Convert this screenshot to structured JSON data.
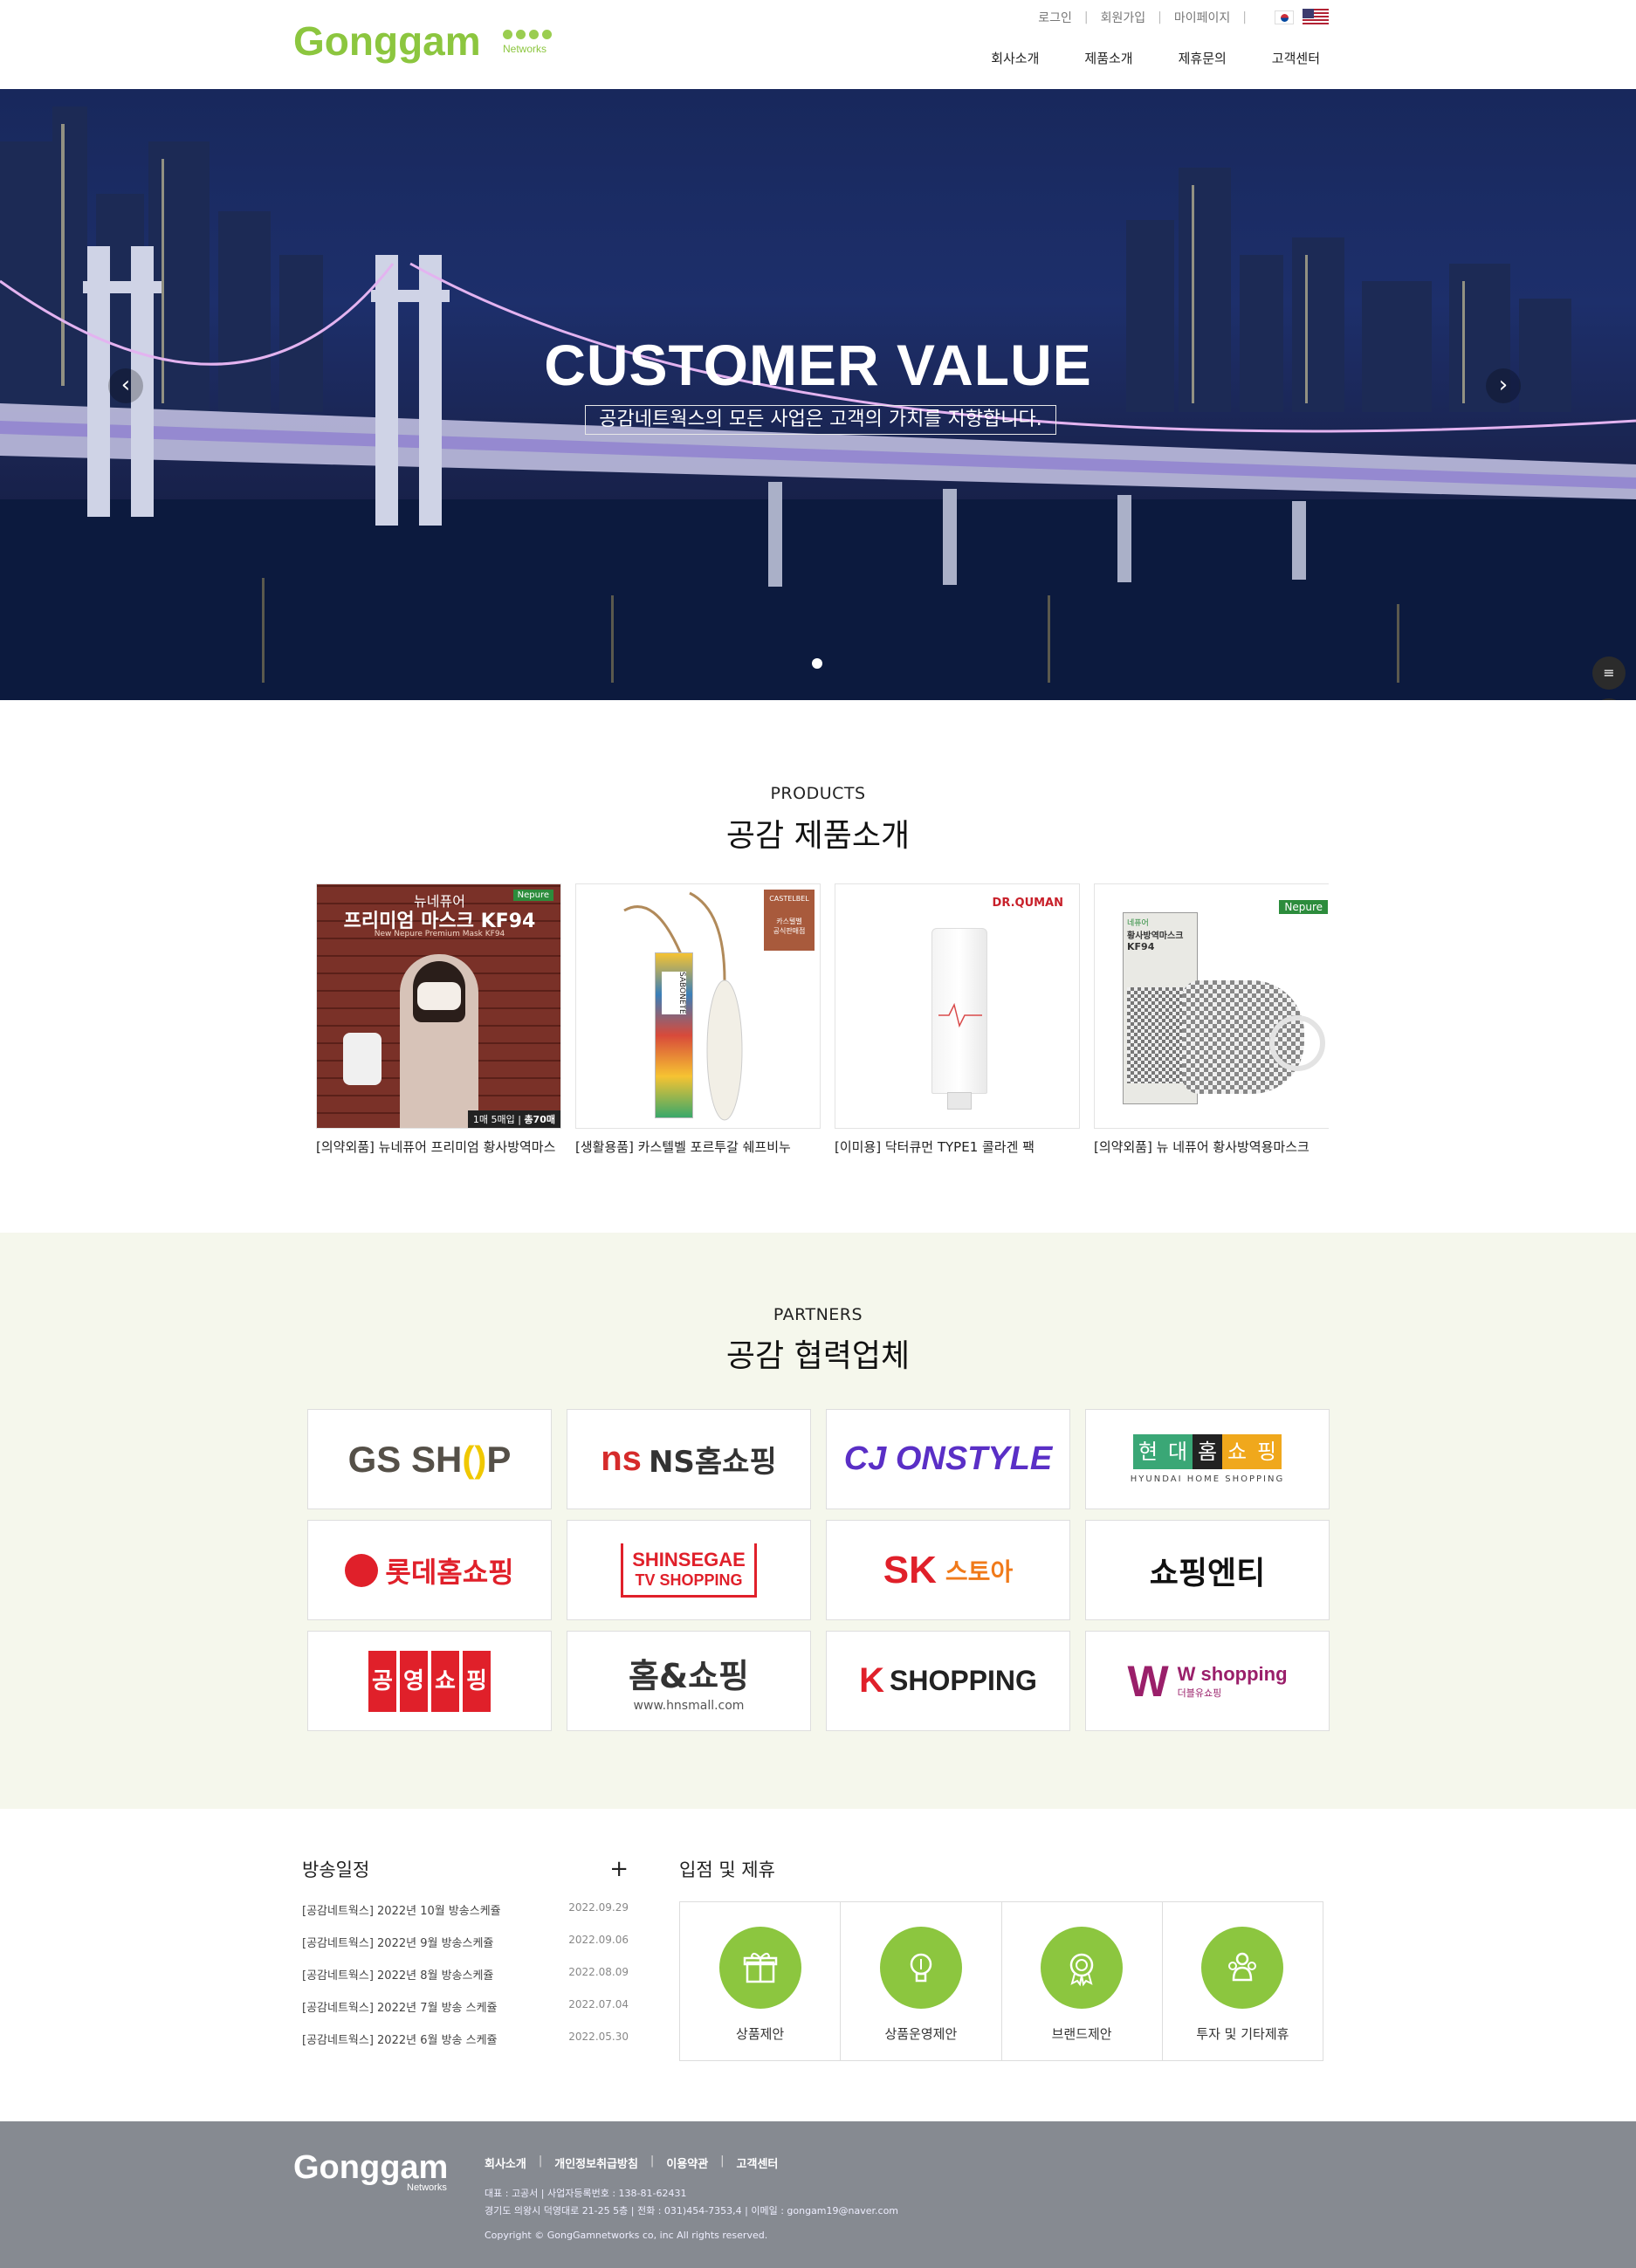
{
  "header": {
    "logo_text": "Gonggam",
    "logo_sub": "Networks",
    "top_links": [
      "로그인",
      "회원가입",
      "마이페이지"
    ],
    "nav": [
      "회사소개",
      "제품소개",
      "제휴문의",
      "고객센터"
    ]
  },
  "hero": {
    "title": "CUSTOMER VALUE",
    "subtitle": "공감네트웍스의 모든 사업은 고객의 가치를 지향합니다."
  },
  "products": {
    "label_en": "PRODUCTS",
    "label_ko": "공감 제품소개",
    "items": [
      {
        "name": "[의약외품] 뉴네퓨어 프리미엄 황사방역마스",
        "img_text_1": "뉴네퓨어",
        "img_text_2": "프리미엄 마스크 KF94",
        "img_text_3": "New Nepure Premium Mask KF94",
        "badge": "Nepure",
        "count": "1매 5매입",
        "count2": "총70매"
      },
      {
        "name": "[생활용품] 카스텔벨 포르투갈 쉐프비누",
        "img_text_1": "CASTELBEL",
        "img_text_2": "카스텔벨",
        "img_text_3": "공식판매점",
        "soap_text": "SABONETE"
      },
      {
        "name": "[이미용] 닥터큐먼 TYPE1 콜라겐 팩",
        "img_text_1": "DR.QUMAN"
      },
      {
        "name": "[의약외품] 뉴 네퓨어 황사방역용마스크",
        "img_text_1": "Nepure",
        "img_text_2": "네퓨어",
        "img_text_3": "황사방역마스크",
        "img_text_4": "KF94"
      }
    ]
  },
  "partners": {
    "label_en": "PARTNERS",
    "label_ko": "공감 협력업체",
    "logos": [
      {
        "name": "GS SHOP",
        "text_a": "GS SH",
        "text_b": "P"
      },
      {
        "name": "NS홈쇼핑",
        "mark": "ns",
        "text": "NS홈쇼핑"
      },
      {
        "name": "CJ ONSTYLE",
        "text": "CJ ONSTYLE"
      },
      {
        "name": "현대홈쇼핑",
        "chars": [
          "현",
          "대",
          "홈",
          "쇼",
          "핑"
        ],
        "sub": "HYUNDAI HOME SHOPPING"
      },
      {
        "name": "롯데홈쇼핑",
        "text": "롯데홈쇼핑"
      },
      {
        "name": "SHINSEGAE TV SHOPPING",
        "line1": "SHINSEGAE",
        "line2": "TV SHOPPING"
      },
      {
        "name": "SK스토아",
        "text_a": "SK",
        "text_b": "스토아"
      },
      {
        "name": "쇼핑엔티",
        "text": "쇼핑엔티"
      },
      {
        "name": "공영쇼핑",
        "chars": [
          "공",
          "영",
          "쇼",
          "핑"
        ]
      },
      {
        "name": "홈&쇼핑",
        "text": "홈&쇼핑",
        "sub": "www.hnsmall.com"
      },
      {
        "name": "K SHOPPING",
        "text": "SHOPPING"
      },
      {
        "name": "W shopping",
        "text": "W shopping",
        "sub": "더블유쇼핑"
      }
    ]
  },
  "schedule": {
    "title": "방송일정",
    "more": "+",
    "rows": [
      {
        "title": "[공감네트웍스] 2022년 10월 방송스케쥴",
        "date": "2022.09.29"
      },
      {
        "title": "[공감네트웍스] 2022년 9월 방송스케쥴",
        "date": "2022.09.06"
      },
      {
        "title": "[공감네트웍스] 2022년 8월 방송스케쥴",
        "date": "2022.08.09"
      },
      {
        "title": "[공감네트웍스] 2022년 7월 방송 스케쥴",
        "date": "2022.07.04"
      },
      {
        "title": "[공감네트웍스] 2022년 6월 방송 스케쥴",
        "date": "2022.05.30"
      }
    ]
  },
  "partnering": {
    "title": "입점 및 제휴",
    "cards": [
      {
        "label": "상품제안",
        "icon": "gift-icon"
      },
      {
        "label": "상품운영제안",
        "icon": "lightbulb-icon"
      },
      {
        "label": "브랜드제안",
        "icon": "medal-icon"
      },
      {
        "label": "투자 및 기타제휴",
        "icon": "people-icon"
      }
    ]
  },
  "footer": {
    "logo_text": "Gonggam",
    "logo_sub": "Networks",
    "links": [
      "회사소개",
      "개인정보취급방침",
      "이용약관",
      "고객센터"
    ],
    "info_line1": "대표 : 고공서    |    사업자등록번호 : 138-81-62431",
    "info_line2": "경기도 의왕시 덕영대로 21-25 5층    |    전화 : 031)454-7353,4    |    이메일 : gongam19@naver.com",
    "copyright": "Copyright © GongGamnetworks co, inc All rights reserved."
  },
  "colors": {
    "brand_green": "#8cc63f",
    "partners_bg": "#f5f7ec",
    "footer_bg": "#868a91"
  }
}
